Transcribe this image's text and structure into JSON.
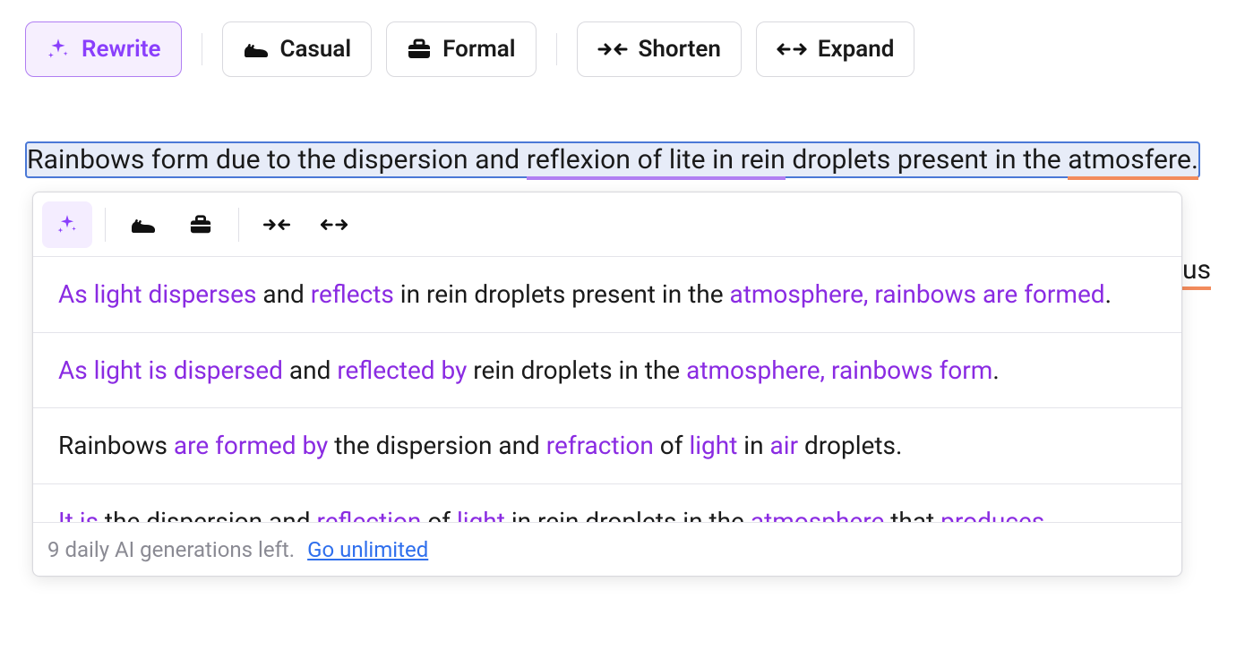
{
  "toolbar": {
    "rewrite": "Rewrite",
    "casual": "Casual",
    "formal": "Formal",
    "shorten": "Shorten",
    "expand": "Expand"
  },
  "editor": {
    "selected_prefix": "Rainbows form due to the dispersion and ",
    "selected_underlined": "reflexion of lite in rein",
    "selected_mid": " droplets present in the ",
    "selected_err2": "atmosfere.",
    "outside_fragment": "us"
  },
  "suggestions": [
    {
      "parts": [
        {
          "t": "As light disperses",
          "hl": true
        },
        {
          "t": " and "
        },
        {
          "t": "reflects",
          "hl": true
        },
        {
          "t": " in rein droplets present in the "
        },
        {
          "t": "atmosphere, rainbows are formed",
          "hl": true
        },
        {
          "t": "."
        }
      ]
    },
    {
      "parts": [
        {
          "t": "As light is dispersed",
          "hl": true
        },
        {
          "t": " and "
        },
        {
          "t": "reflected by",
          "hl": true
        },
        {
          "t": " rein droplets in the "
        },
        {
          "t": "atmosphere, rainbows form",
          "hl": true
        },
        {
          "t": "."
        }
      ]
    },
    {
      "parts": [
        {
          "t": "Rainbows "
        },
        {
          "t": "are formed by",
          "hl": true
        },
        {
          "t": " the dispersion and "
        },
        {
          "t": "refraction",
          "hl": true
        },
        {
          "t": " of "
        },
        {
          "t": "light",
          "hl": true
        },
        {
          "t": " in "
        },
        {
          "t": "air",
          "hl": true
        },
        {
          "t": " droplets."
        }
      ]
    },
    {
      "parts": [
        {
          "t": "It is",
          "hl": true
        },
        {
          "t": " the dispersion and "
        },
        {
          "t": "reflection",
          "hl": true
        },
        {
          "t": " of "
        },
        {
          "t": "light",
          "hl": true
        },
        {
          "t": " in rein droplets in the "
        },
        {
          "t": "atmosphere",
          "hl": true
        },
        {
          "t": " that "
        },
        {
          "t": "produces rainbows",
          "hl": true
        },
        {
          "t": "."
        }
      ]
    }
  ],
  "footer": {
    "status": "9 daily AI generations left.",
    "link": "Go unlimited"
  },
  "icons": {
    "sparkles": "sparkles-icon",
    "shoe": "shoe-icon",
    "briefcase": "briefcase-icon",
    "shorten": "shorten-icon",
    "expand": "expand-icon"
  }
}
